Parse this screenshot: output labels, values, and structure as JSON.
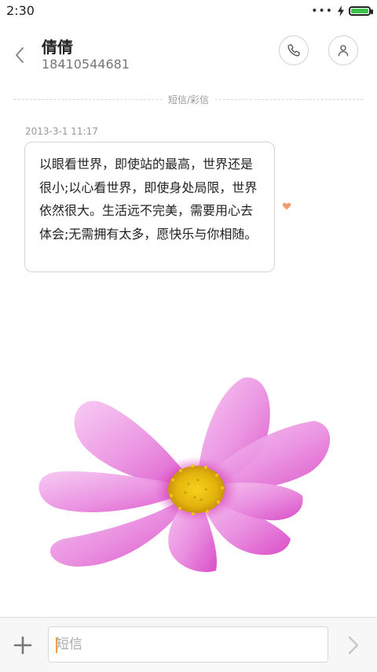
{
  "status_bar": {
    "time": "2:30",
    "icons": [
      "more-dots-icon",
      "charging-bolt-icon",
      "battery-icon"
    ],
    "battery_color": "#3cc14a"
  },
  "header": {
    "contact_name": "倩倩",
    "phone_number": "18410544681",
    "icons": [
      "back-chevron-icon",
      "phone-icon",
      "person-icon"
    ]
  },
  "thread": {
    "type_label": "短信/彩信",
    "message": {
      "timestamp": "2013-3-1 11:17",
      "text": "以眼看世界，即使站的最高，世界还是很小;以心看世界，即使身处局限，世界依然很大。生活远不完美，需要用心去体会;无需拥有太多，愿快乐与你相随。",
      "favorite_icon": "heart-icon",
      "favorite_color": "#f39a6a"
    },
    "attachment": {
      "kind": "image",
      "subject": "pink-cosmos-flower-image"
    }
  },
  "composer": {
    "placeholder": "短信",
    "value": "",
    "add_icon": "plus-icon",
    "send_icon": "send-chevron-icon",
    "caret_color": "#f39c4a"
  }
}
